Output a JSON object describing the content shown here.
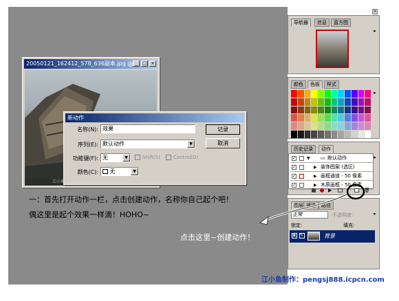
{
  "document": {
    "title": "20050121_162412_578_636副本.jpg @ ...",
    "watermark": "江小鱼制作：http://pengsj888.icpcn.com"
  },
  "dialog": {
    "title": "新动作",
    "name_label": "名称(N):",
    "name_value": "效果",
    "set_label": "序列(E):",
    "set_value": "默认动作",
    "fkey_label": "功能键(F):",
    "fkey_value": "无",
    "shift_label": "Shift(S)",
    "control_label": "Control(O)",
    "color_label": "颜色(C):",
    "color_value": "无",
    "record_button": "记录",
    "cancel_button": "取消"
  },
  "navigator_panel": {
    "tabs": [
      "导航器",
      "信息",
      "直方图"
    ]
  },
  "swatches_panel": {
    "tabs": [
      "颜色",
      "色板",
      "样式"
    ]
  },
  "actions_panel": {
    "tabs": [
      "历史记录",
      "动作"
    ],
    "rows": [
      {
        "label": "默认动作",
        "kind": "set"
      },
      {
        "label": "装饰图案 (选区)",
        "kind": "action"
      },
      {
        "label": "画框通道 - 50 像素",
        "kind": "action"
      },
      {
        "label": "木质画框 - 50 像素",
        "kind": "action"
      }
    ]
  },
  "layers_panel": {
    "tabs": [
      "图层",
      "通道",
      "路径"
    ],
    "blend_mode": "正常",
    "opacity_label": "不透明度:",
    "lock_label": "锁定:",
    "fill_label": "填充:",
    "layer_name": "背景"
  },
  "annotations": {
    "line1": "一：首先打开动作一栏，点击创建动作，名称你自己起个吧！",
    "line2": "偶这里是起个效果一样滴！HOHO~",
    "click_hint": "点击这里~创建动作！",
    "footer_prefix": "江小鱼制作：",
    "footer_url": "pengsj888.icpcn.com"
  },
  "colors": {
    "title_bar": "#0a246a",
    "panel_bg": "#d4d0c8",
    "canvas_gray": "#8a8a8a",
    "layer_selected": "#0a246a",
    "footer_blue": "#1a3caa"
  }
}
